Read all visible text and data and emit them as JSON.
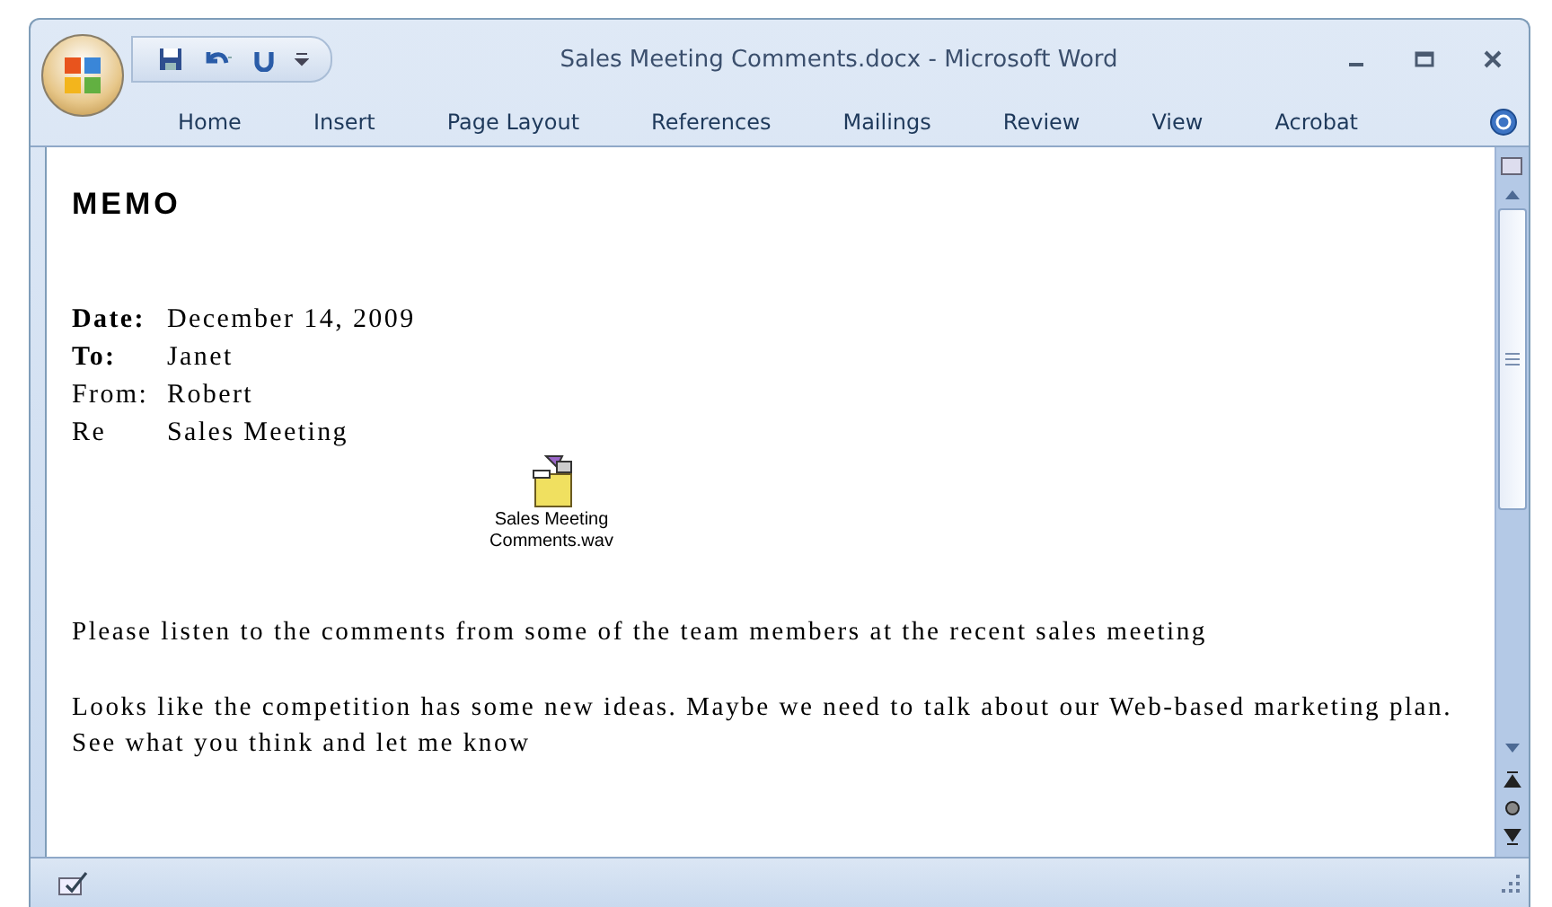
{
  "window": {
    "title": "Sales Meeting Comments.docx - Microsoft Word"
  },
  "tabs": [
    {
      "label": "Home",
      "selected": false
    },
    {
      "label": "Insert",
      "selected": false
    },
    {
      "label": "Page Layout",
      "selected": false
    },
    {
      "label": "References",
      "selected": false
    },
    {
      "label": "Mailings",
      "selected": false
    },
    {
      "label": "Review",
      "selected": false
    },
    {
      "label": "View",
      "selected": false
    },
    {
      "label": "Acrobat",
      "selected": false
    }
  ],
  "document": {
    "heading": "MEMO",
    "fields": [
      {
        "label": "Date:",
        "value": "December 14, 2009",
        "bold": true
      },
      {
        "label": "To:",
        "value": "Janet",
        "bold": true
      },
      {
        "label": "From:",
        "value": "Robert",
        "bold": false
      },
      {
        "label": "Re",
        "value": "Sales Meeting",
        "bold": false
      }
    ],
    "attachment": {
      "name": "Sales Meeting Comments.wav"
    },
    "paragraphs": [
      "Please listen to the comments from some of the team members at the recent sales meeting",
      "Looks like the competition has some new ideas. Maybe we need to talk about our Web-based marketing plan. See what you think and let me know"
    ]
  }
}
